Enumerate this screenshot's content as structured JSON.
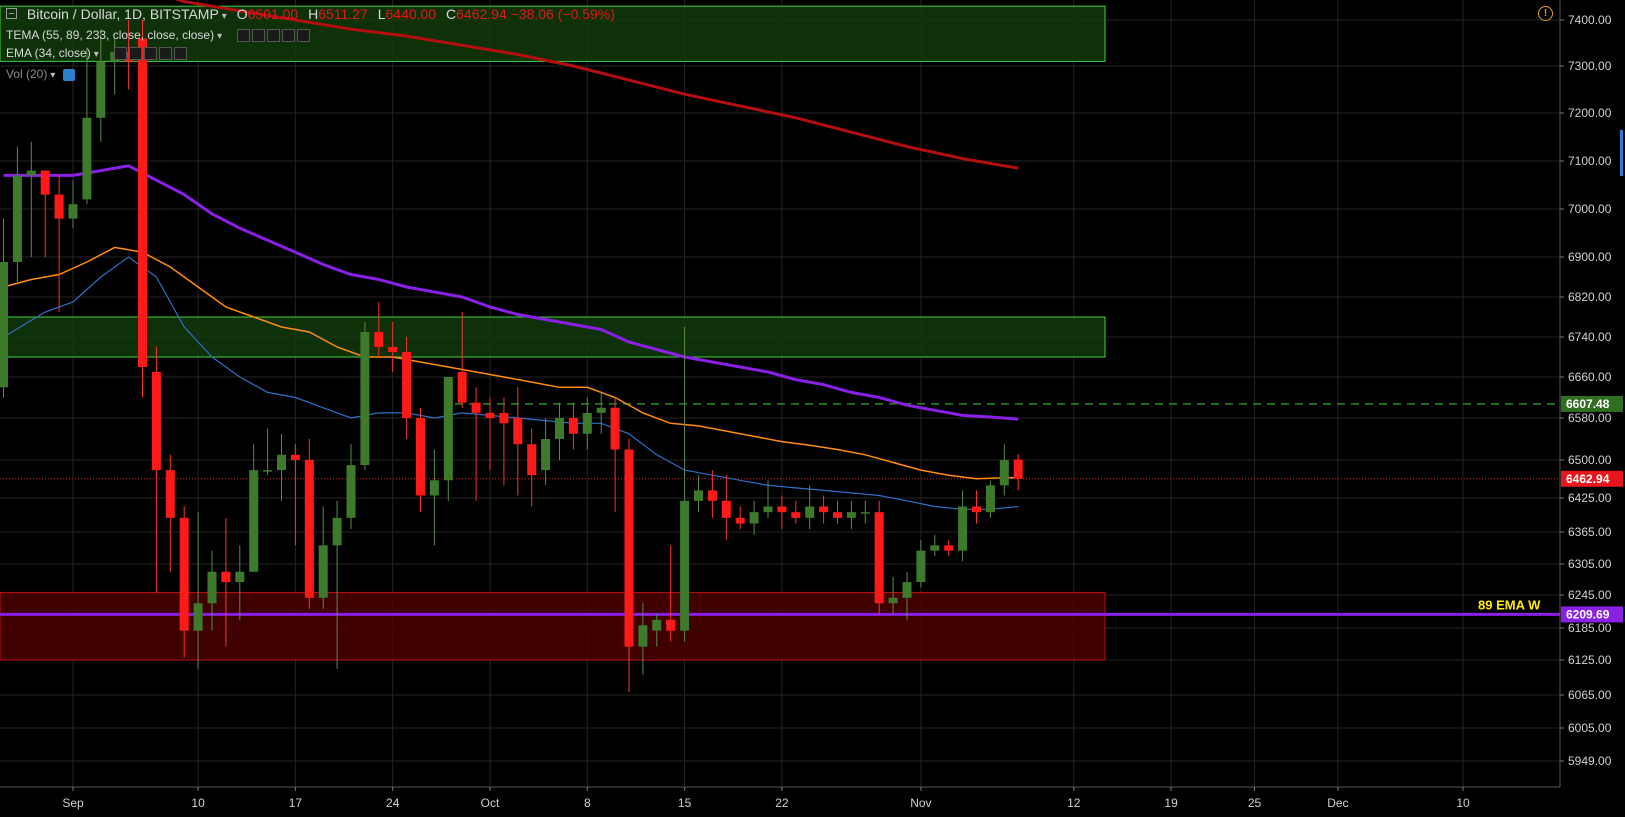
{
  "header": {
    "symbol": "Bitcoin / Dollar, 1D, BITSTAMP",
    "o_label": "O",
    "o_value": "6501.00",
    "h_label": "H",
    "h_value": "6511.27",
    "l_label": "L",
    "l_value": "6440.00",
    "c_label": "C",
    "c_value": "6462.94",
    "change": "−38.06 (−0.59%)"
  },
  "indicators": [
    {
      "label": "TEMA (55, 89, 233, close, close, close)"
    },
    {
      "label": "EMA (34, close)"
    },
    {
      "label": "Vol (20)"
    }
  ],
  "colors": {
    "up": "#3e7a2b",
    "down": "#ff1a1a",
    "ema34": "#2f6fc9",
    "tema55": "#ff8c10",
    "tema89": "#8a1fe6",
    "tema233": "#b30f0f",
    "zone_green": "#113a0a",
    "zone_red": "#4a0000",
    "price_line": "#e8151c",
    "level_dash": "#2a8a20",
    "ema89_label": "#ffee00"
  },
  "chart_data": {
    "type": "candlestick",
    "y_axis": {
      "ticks": [
        "7400.00",
        "7300.00",
        "7200.00",
        "7100.00",
        "7000.00",
        "6900.00",
        "6820.00",
        "6740.00",
        "6660.00",
        "6580.00",
        "6500.00",
        "6425.00",
        "6365.00",
        "6305.00",
        "6245.00",
        "6185.00",
        "6125.00",
        "6065.00",
        "6005.00",
        "5949.00"
      ]
    },
    "x_axis": {
      "ticks": [
        {
          "label": "Sep",
          "day": 0
        },
        {
          "label": "10",
          "day": 9
        },
        {
          "label": "17",
          "day": 16
        },
        {
          "label": "24",
          "day": 23
        },
        {
          "label": "Oct",
          "day": 30
        },
        {
          "label": "8",
          "day": 37
        },
        {
          "label": "15",
          "day": 44
        },
        {
          "label": "22",
          "day": 51
        },
        {
          "label": "Nov",
          "day": 61
        },
        {
          "label": "12",
          "day": 72
        },
        {
          "label": "19",
          "day": 79
        },
        {
          "label": "25",
          "day": 85
        },
        {
          "label": "Dec",
          "day": 91
        },
        {
          "label": "10",
          "day": 100
        }
      ]
    },
    "candles": [
      {
        "d": -5,
        "o": 6640,
        "h": 6980,
        "l": 6620,
        "c": 6890
      },
      {
        "d": -4,
        "o": 6890,
        "h": 7130,
        "l": 6850,
        "c": 7070
      },
      {
        "d": -3,
        "o": 7070,
        "h": 7140,
        "l": 6900,
        "c": 7080
      },
      {
        "d": -2,
        "o": 7080,
        "h": 7080,
        "l": 6900,
        "c": 7030
      },
      {
        "d": -1,
        "o": 7030,
        "h": 7070,
        "l": 6790,
        "c": 6980
      },
      {
        "d": 0,
        "o": 6980,
        "h": 7060,
        "l": 6960,
        "c": 7010
      },
      {
        "d": 1,
        "o": 7020,
        "h": 7340,
        "l": 7010,
        "c": 7190
      },
      {
        "d": 2,
        "o": 7190,
        "h": 7380,
        "l": 7140,
        "c": 7310
      },
      {
        "d": 3,
        "o": 7310,
        "h": 7360,
        "l": 7240,
        "c": 7330
      },
      {
        "d": 4,
        "o": 7330,
        "h": 7400,
        "l": 7250,
        "c": 7310
      },
      {
        "d": 5,
        "o": 7360,
        "h": 7400,
        "l": 6620,
        "c": 6680
      },
      {
        "d": 6,
        "o": 6670,
        "h": 6720,
        "l": 6250,
        "c": 6480
      },
      {
        "d": 7,
        "o": 6480,
        "h": 6510,
        "l": 6290,
        "c": 6390
      },
      {
        "d": 8,
        "o": 6390,
        "h": 6410,
        "l": 6130,
        "c": 6180
      },
      {
        "d": 9,
        "o": 6180,
        "h": 6400,
        "l": 6110,
        "c": 6230
      },
      {
        "d": 10,
        "o": 6230,
        "h": 6330,
        "l": 6180,
        "c": 6290
      },
      {
        "d": 11,
        "o": 6290,
        "h": 6390,
        "l": 6150,
        "c": 6270
      },
      {
        "d": 12,
        "o": 6270,
        "h": 6340,
        "l": 6200,
        "c": 6290
      },
      {
        "d": 13,
        "o": 6290,
        "h": 6530,
        "l": 6290,
        "c": 6480
      },
      {
        "d": 14,
        "o": 6480,
        "h": 6560,
        "l": 6470,
        "c": 6480
      },
      {
        "d": 15,
        "o": 6480,
        "h": 6550,
        "l": 6420,
        "c": 6510
      },
      {
        "d": 16,
        "o": 6510,
        "h": 6530,
        "l": 6340,
        "c": 6500
      },
      {
        "d": 17,
        "o": 6500,
        "h": 6540,
        "l": 6220,
        "c": 6240
      },
      {
        "d": 18,
        "o": 6240,
        "h": 6410,
        "l": 6220,
        "c": 6340
      },
      {
        "d": 19,
        "o": 6340,
        "h": 6420,
        "l": 6110,
        "c": 6390
      },
      {
        "d": 20,
        "o": 6390,
        "h": 6530,
        "l": 6370,
        "c": 6490
      },
      {
        "d": 21,
        "o": 6490,
        "h": 6770,
        "l": 6480,
        "c": 6750
      },
      {
        "d": 22,
        "o": 6750,
        "h": 6810,
        "l": 6700,
        "c": 6720
      },
      {
        "d": 23,
        "o": 6720,
        "h": 6770,
        "l": 6670,
        "c": 6710
      },
      {
        "d": 24,
        "o": 6710,
        "h": 6740,
        "l": 6540,
        "c": 6580
      },
      {
        "d": 25,
        "o": 6580,
        "h": 6600,
        "l": 6400,
        "c": 6430
      },
      {
        "d": 26,
        "o": 6430,
        "h": 6520,
        "l": 6340,
        "c": 6460
      },
      {
        "d": 27,
        "o": 6460,
        "h": 6660,
        "l": 6420,
        "c": 6660
      },
      {
        "d": 28,
        "o": 6670,
        "h": 6790,
        "l": 6600,
        "c": 6610
      },
      {
        "d": 29,
        "o": 6610,
        "h": 6640,
        "l": 6420,
        "c": 6590
      },
      {
        "d": 30,
        "o": 6590,
        "h": 6620,
        "l": 6480,
        "c": 6580
      },
      {
        "d": 31,
        "o": 6590,
        "h": 6620,
        "l": 6450,
        "c": 6570
      },
      {
        "d": 32,
        "o": 6580,
        "h": 6640,
        "l": 6430,
        "c": 6530
      },
      {
        "d": 33,
        "o": 6530,
        "h": 6560,
        "l": 6410,
        "c": 6470
      },
      {
        "d": 34,
        "o": 6480,
        "h": 6580,
        "l": 6450,
        "c": 6540
      },
      {
        "d": 35,
        "o": 6540,
        "h": 6610,
        "l": 6500,
        "c": 6580
      },
      {
        "d": 36,
        "o": 6580,
        "h": 6610,
        "l": 6520,
        "c": 6550
      },
      {
        "d": 37,
        "o": 6550,
        "h": 6620,
        "l": 6520,
        "c": 6590
      },
      {
        "d": 38,
        "o": 6590,
        "h": 6630,
        "l": 6550,
        "c": 6600
      },
      {
        "d": 39,
        "o": 6600,
        "h": 6620,
        "l": 6400,
        "c": 6520
      },
      {
        "d": 40,
        "o": 6520,
        "h": 6540,
        "l": 6070,
        "c": 6150
      },
      {
        "d": 41,
        "o": 6150,
        "h": 6230,
        "l": 6100,
        "c": 6190
      },
      {
        "d": 42,
        "o": 6180,
        "h": 6210,
        "l": 6150,
        "c": 6200
      },
      {
        "d": 43,
        "o": 6200,
        "h": 6340,
        "l": 6160,
        "c": 6180
      },
      {
        "d": 44,
        "o": 6180,
        "h": 6760,
        "l": 6160,
        "c": 6420
      },
      {
        "d": 45,
        "o": 6420,
        "h": 6470,
        "l": 6400,
        "c": 6440
      },
      {
        "d": 46,
        "o": 6440,
        "h": 6480,
        "l": 6390,
        "c": 6420
      },
      {
        "d": 47,
        "o": 6420,
        "h": 6470,
        "l": 6350,
        "c": 6390
      },
      {
        "d": 48,
        "o": 6390,
        "h": 6410,
        "l": 6370,
        "c": 6380
      },
      {
        "d": 49,
        "o": 6380,
        "h": 6420,
        "l": 6360,
        "c": 6400
      },
      {
        "d": 50,
        "o": 6400,
        "h": 6460,
        "l": 6390,
        "c": 6410
      },
      {
        "d": 51,
        "o": 6410,
        "h": 6430,
        "l": 6370,
        "c": 6400
      },
      {
        "d": 52,
        "o": 6400,
        "h": 6420,
        "l": 6380,
        "c": 6390
      },
      {
        "d": 53,
        "o": 6390,
        "h": 6450,
        "l": 6370,
        "c": 6410
      },
      {
        "d": 54,
        "o": 6410,
        "h": 6430,
        "l": 6380,
        "c": 6400
      },
      {
        "d": 55,
        "o": 6400,
        "h": 6420,
        "l": 6380,
        "c": 6390
      },
      {
        "d": 56,
        "o": 6390,
        "h": 6420,
        "l": 6370,
        "c": 6400
      },
      {
        "d": 57,
        "o": 6400,
        "h": 6420,
        "l": 6380,
        "c": 6400
      },
      {
        "d": 58,
        "o": 6400,
        "h": 6420,
        "l": 6210,
        "c": 6230
      },
      {
        "d": 59,
        "o": 6230,
        "h": 6280,
        "l": 6210,
        "c": 6240
      },
      {
        "d": 60,
        "o": 6240,
        "h": 6290,
        "l": 6200,
        "c": 6270
      },
      {
        "d": 61,
        "o": 6270,
        "h": 6350,
        "l": 6260,
        "c": 6330
      },
      {
        "d": 62,
        "o": 6330,
        "h": 6360,
        "l": 6320,
        "c": 6340
      },
      {
        "d": 63,
        "o": 6340,
        "h": 6350,
        "l": 6320,
        "c": 6330
      },
      {
        "d": 64,
        "o": 6330,
        "h": 6440,
        "l": 6310,
        "c": 6410
      },
      {
        "d": 65,
        "o": 6410,
        "h": 6440,
        "l": 6380,
        "c": 6400
      },
      {
        "d": 66,
        "o": 6400,
        "h": 6460,
        "l": 6390,
        "c": 6450
      },
      {
        "d": 67,
        "o": 6450,
        "h": 6530,
        "l": 6430,
        "c": 6500
      },
      {
        "d": 68,
        "o": 6501,
        "h": 6511.27,
        "l": 6440,
        "c": 6462.94
      }
    ],
    "lines": {
      "ema34": [
        [
          -5,
          6740
        ],
        [
          -2,
          6790
        ],
        [
          0,
          6810
        ],
        [
          2,
          6860
        ],
        [
          4,
          6900
        ],
        [
          6,
          6860
        ],
        [
          8,
          6760
        ],
        [
          10,
          6700
        ],
        [
          12,
          6660
        ],
        [
          14,
          6630
        ],
        [
          16,
          6620
        ],
        [
          18,
          6600
        ],
        [
          20,
          6580
        ],
        [
          22,
          6590
        ],
        [
          24,
          6590
        ],
        [
          26,
          6580
        ],
        [
          28,
          6590
        ],
        [
          30,
          6585
        ],
        [
          32,
          6580
        ],
        [
          34,
          6575
        ],
        [
          36,
          6570
        ],
        [
          38,
          6570
        ],
        [
          40,
          6550
        ],
        [
          42,
          6510
        ],
        [
          44,
          6480
        ],
        [
          46,
          6470
        ],
        [
          48,
          6460
        ],
        [
          50,
          6450
        ],
        [
          52,
          6445
        ],
        [
          54,
          6440
        ],
        [
          56,
          6435
        ],
        [
          58,
          6430
        ],
        [
          60,
          6420
        ],
        [
          62,
          6410
        ],
        [
          64,
          6405
        ],
        [
          66,
          6405
        ],
        [
          68,
          6410
        ]
      ],
      "tema55": [
        [
          -5,
          6840
        ],
        [
          -3,
          6855
        ],
        [
          -1,
          6865
        ],
        [
          1,
          6890
        ],
        [
          3,
          6920
        ],
        [
          5,
          6910
        ],
        [
          7,
          6880
        ],
        [
          9,
          6840
        ],
        [
          11,
          6800
        ],
        [
          13,
          6780
        ],
        [
          15,
          6760
        ],
        [
          17,
          6750
        ],
        [
          19,
          6720
        ],
        [
          21,
          6700
        ],
        [
          23,
          6700
        ],
        [
          25,
          6690
        ],
        [
          27,
          6680
        ],
        [
          29,
          6670
        ],
        [
          31,
          6660
        ],
        [
          33,
          6650
        ],
        [
          35,
          6640
        ],
        [
          37,
          6640
        ],
        [
          39,
          6620
        ],
        [
          41,
          6590
        ],
        [
          43,
          6570
        ],
        [
          45,
          6565
        ],
        [
          47,
          6555
        ],
        [
          49,
          6545
        ],
        [
          51,
          6535
        ],
        [
          53,
          6528
        ],
        [
          55,
          6520
        ],
        [
          57,
          6510
        ],
        [
          59,
          6495
        ],
        [
          61,
          6480
        ],
        [
          63,
          6470
        ],
        [
          65,
          6463
        ],
        [
          67,
          6465
        ],
        [
          68,
          6465
        ]
      ],
      "tema89": [
        [
          -5,
          7070
        ],
        [
          -2,
          7070
        ],
        [
          0,
          7070
        ],
        [
          2,
          7080
        ],
        [
          4,
          7090
        ],
        [
          6,
          7060
        ],
        [
          8,
          7030
        ],
        [
          10,
          6990
        ],
        [
          12,
          6960
        ],
        [
          14,
          6935
        ],
        [
          16,
          6910
        ],
        [
          18,
          6885
        ],
        [
          20,
          6865
        ],
        [
          22,
          6855
        ],
        [
          24,
          6840
        ],
        [
          26,
          6830
        ],
        [
          28,
          6820
        ],
        [
          30,
          6800
        ],
        [
          32,
          6785
        ],
        [
          34,
          6775
        ],
        [
          36,
          6765
        ],
        [
          38,
          6755
        ],
        [
          40,
          6730
        ],
        [
          42,
          6715
        ],
        [
          44,
          6700
        ],
        [
          46,
          6690
        ],
        [
          48,
          6680
        ],
        [
          50,
          6670
        ],
        [
          52,
          6655
        ],
        [
          54,
          6645
        ],
        [
          56,
          6630
        ],
        [
          58,
          6620
        ],
        [
          60,
          6605
        ],
        [
          62,
          6595
        ],
        [
          64,
          6585
        ],
        [
          66,
          6582
        ],
        [
          68,
          6578
        ]
      ],
      "tema233": [
        [
          1,
          7520
        ],
        [
          3,
          7500
        ],
        [
          5,
          7470
        ],
        [
          8,
          7440
        ],
        [
          12,
          7420
        ],
        [
          16,
          7400
        ],
        [
          20,
          7380
        ],
        [
          24,
          7365
        ],
        [
          28,
          7345
        ],
        [
          32,
          7325
        ],
        [
          36,
          7300
        ],
        [
          40,
          7270
        ],
        [
          44,
          7240
        ],
        [
          48,
          7215
        ],
        [
          52,
          7190
        ],
        [
          56,
          7160
        ],
        [
          60,
          7130
        ],
        [
          64,
          7105
        ],
        [
          68,
          7085
        ]
      ]
    },
    "zones": [
      {
        "name": "supply-top",
        "from": 7310,
        "to": 7430,
        "color": "green"
      },
      {
        "name": "resistance",
        "from": 6700,
        "to": 6780,
        "color": "green"
      },
      {
        "name": "support",
        "from": 6125,
        "to": 6250,
        "color": "red"
      }
    ],
    "level_line": {
      "value": 6607.48,
      "label": "6607.48"
    },
    "ema89_weekly": {
      "value": 6209.69,
      "label": "6209.69",
      "text": "89 EMA W"
    },
    "last_price": {
      "value": 6462.94,
      "label": "6462.94"
    }
  }
}
